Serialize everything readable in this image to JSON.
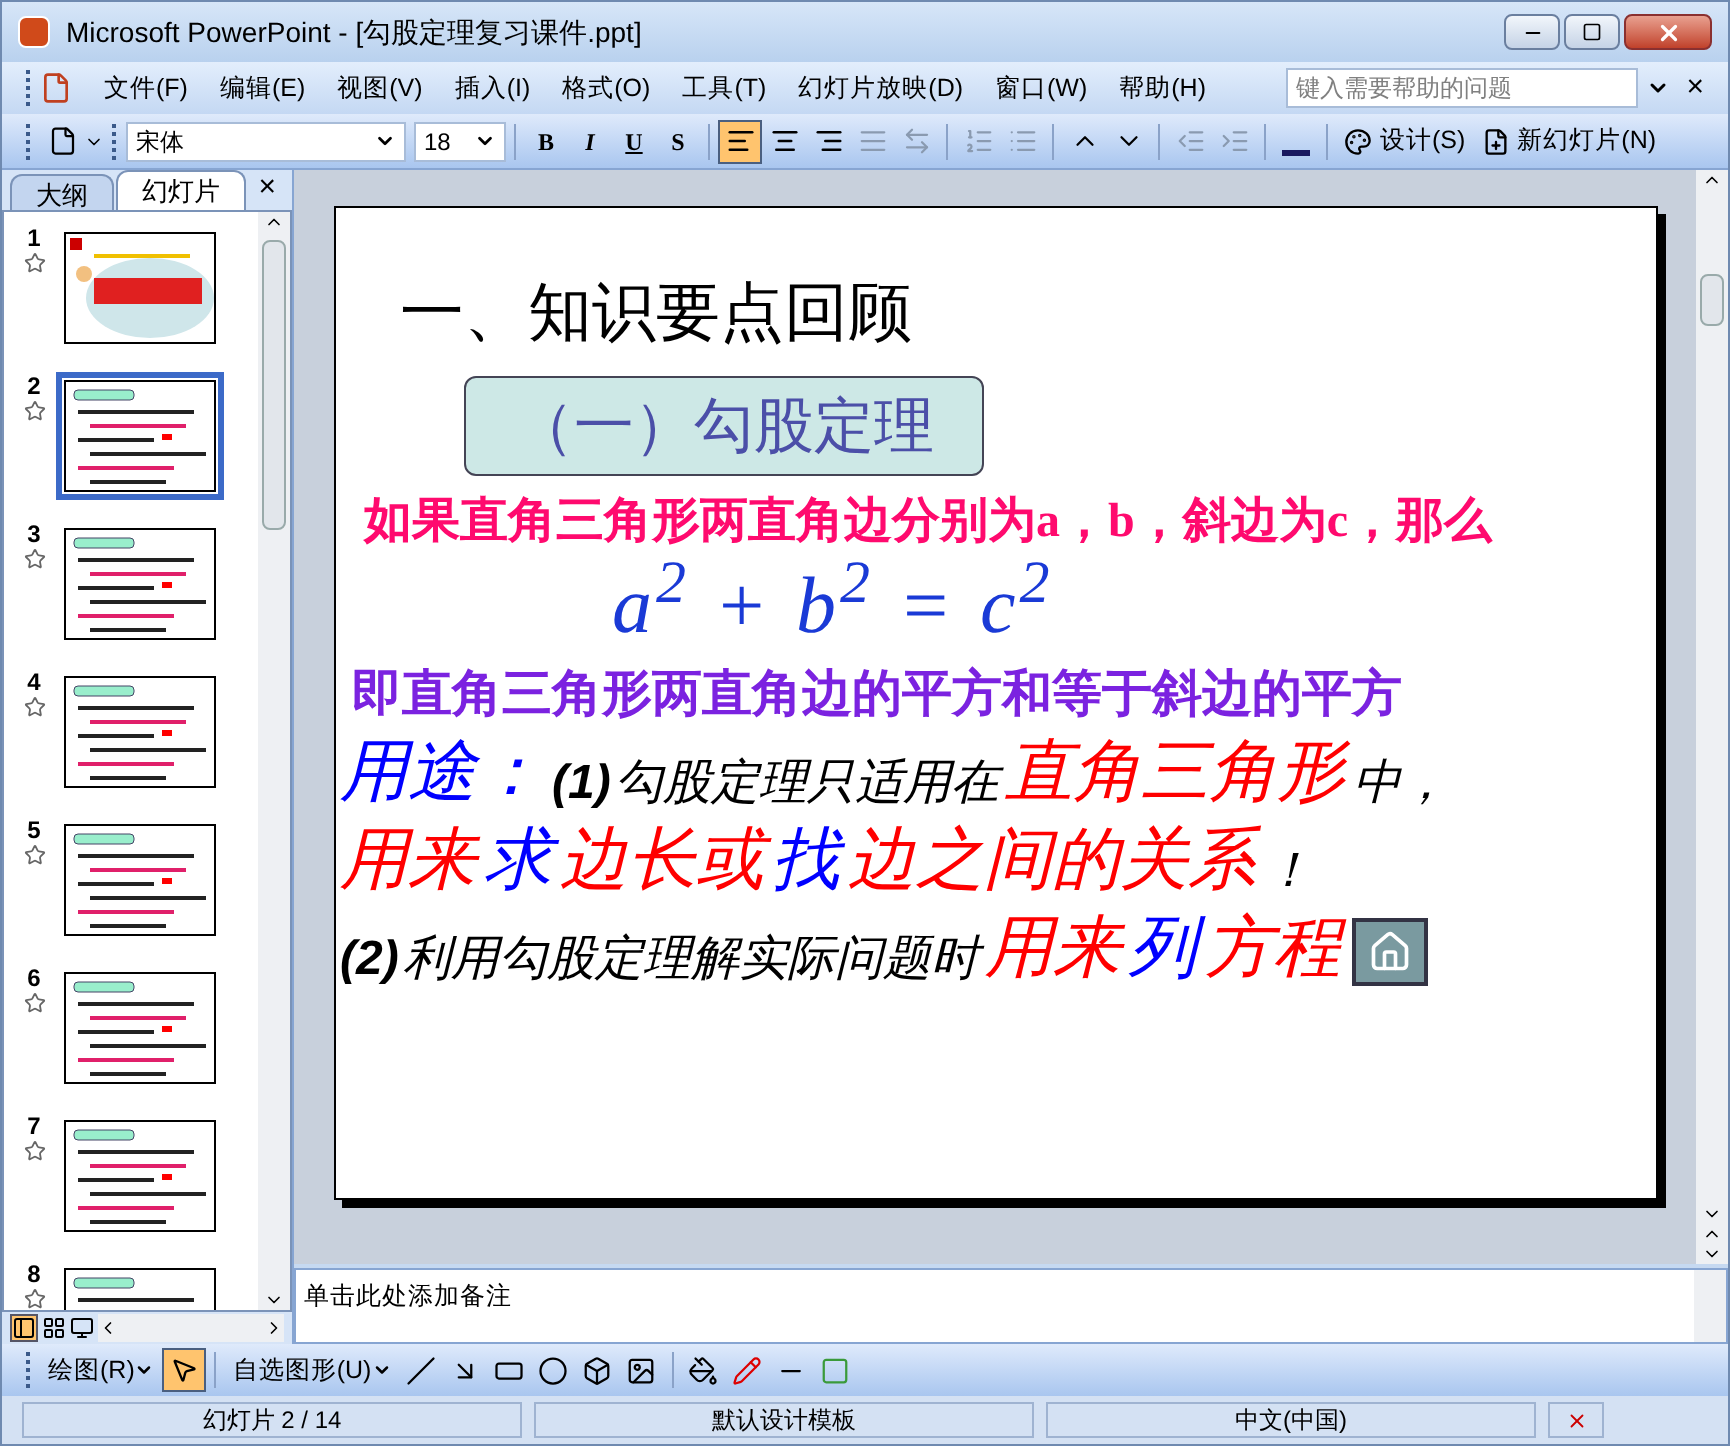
{
  "window": {
    "title": "Microsoft PowerPoint - [勾股定理复习课件.ppt]"
  },
  "menu": [
    "文件(F)",
    "编辑(E)",
    "视图(V)",
    "插入(I)",
    "格式(O)",
    "工具(T)",
    "幻灯片放映(D)",
    "窗口(W)",
    "帮助(H)"
  ],
  "help_search": {
    "placeholder": "键入需要帮助的问题"
  },
  "close_char": "×",
  "formatting": {
    "font": "宋体",
    "size": "18",
    "style_buttons": [
      "B",
      "I",
      "U",
      "S"
    ],
    "alignment": [
      {
        "kind": "left",
        "selected": true
      },
      {
        "kind": "center",
        "selected": false
      },
      {
        "kind": "right",
        "selected": false
      }
    ],
    "design_button": "设计(S)",
    "new_slide_button": "新幻灯片(N)"
  },
  "panel": {
    "tabs": [
      {
        "label": "大纲",
        "selected": false
      },
      {
        "label": "幻灯片",
        "selected": true
      }
    ],
    "close": "×",
    "slides": [
      {
        "number": "1",
        "kind": "title",
        "selected": false
      },
      {
        "number": "2",
        "kind": "text",
        "selected": true
      },
      {
        "number": "3",
        "kind": "text",
        "selected": false
      },
      {
        "number": "4",
        "kind": "text",
        "selected": false
      },
      {
        "number": "5",
        "kind": "text",
        "selected": false
      },
      {
        "number": "6",
        "kind": "text",
        "selected": false
      },
      {
        "number": "7",
        "kind": "text",
        "selected": false
      },
      {
        "number": "8",
        "kind": "text",
        "selected": false
      }
    ]
  },
  "slide": {
    "heading": "一、知识要点回顾",
    "section": "（一）勾股定理",
    "statement": "如果直角三角形两直角边分别为a，b，斜边为c，那么",
    "formula": "a$^{2}$ + b$^{2}$ = c$^{2}$",
    "summary": "即直角三角形两直角边的平方和等于斜边的平方",
    "usage": [
      [
        {
          "text": "用途：",
          "color": "#0000ff",
          "kind": "big"
        },
        {
          "text": "(1)",
          "color": "#000000",
          "kind": "bold"
        },
        {
          "text": "勾股定理只适用在",
          "color": "#000000",
          "kind": "plain"
        },
        {
          "text": "直角三角形",
          "color": "#ff0000",
          "kind": "big"
        },
        {
          "text": "中，",
          "color": "#000000",
          "kind": "plain"
        }
      ],
      [
        {
          "text": "用来",
          "color": "#ff0000",
          "kind": "big"
        },
        {
          "text": "求",
          "color": "#0000ff",
          "kind": "big"
        },
        {
          "text": "边长或",
          "color": "#ff0000",
          "kind": "big"
        },
        {
          "text": "找",
          "color": "#0000ff",
          "kind": "big"
        },
        {
          "text": "边之间的关系",
          "color": "#ff0000",
          "kind": "big"
        },
        {
          "text": "！",
          "color": "#000000",
          "kind": "plain"
        }
      ],
      [
        {
          "text": "(2)",
          "color": "#000000",
          "kind": "bold"
        },
        {
          "text": "利用勾股定理解实际问题时",
          "color": "#000000",
          "kind": "plain"
        },
        {
          "text": "用来",
          "color": "#ff0000",
          "kind": "big"
        },
        {
          "text": "列",
          "color": "#0000ff",
          "kind": "big"
        },
        {
          "text": "方程",
          "color": "#ff0000",
          "kind": "big"
        }
      ]
    ]
  },
  "notes": "单击此处添加备注",
  "drawing": {
    "draw_menu": "绘图(R)",
    "autoshapes": "自选图形(U)"
  },
  "status_bar": [
    "幻灯片 2 / 14",
    "默认设计模板",
    "中文(中国)"
  ]
}
